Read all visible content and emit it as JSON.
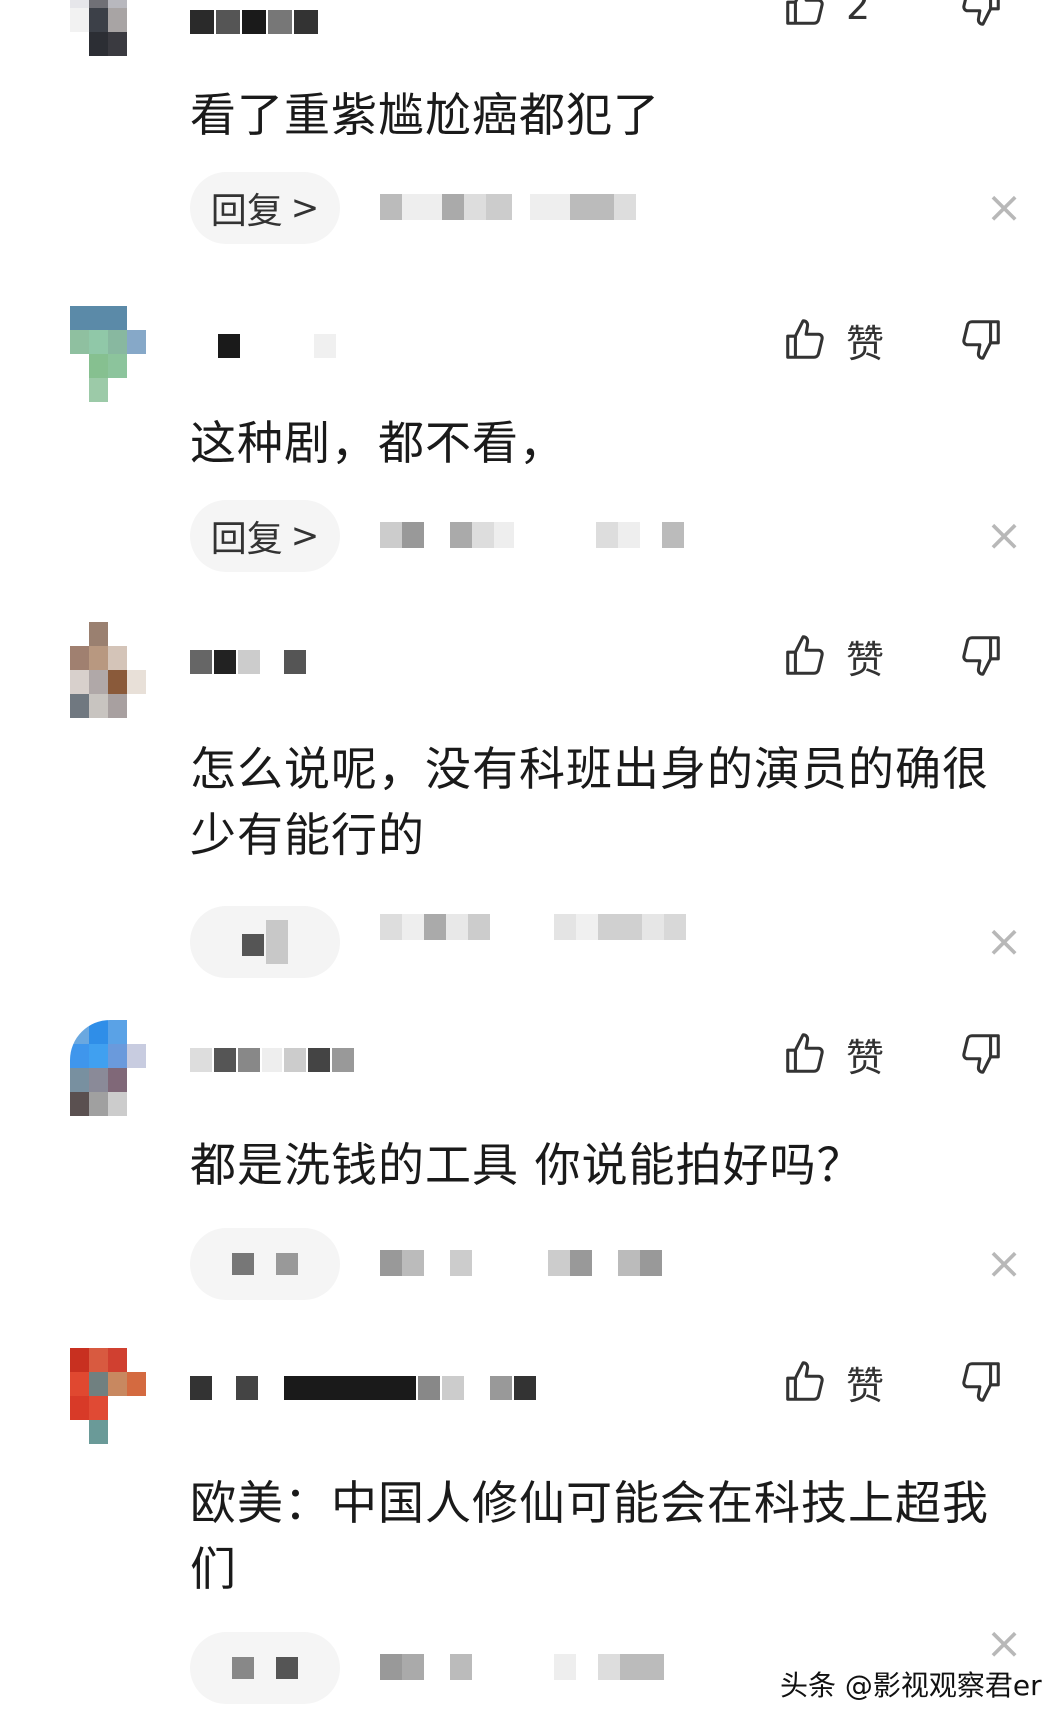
{
  "comments": [
    {
      "like_label": "2",
      "text": "看了重紫尴尬癌都犯了",
      "reply_label": "回复",
      "reply_chevron": ">",
      "close_glyph": "×"
    },
    {
      "like_label": "赞",
      "text": "这种剧，都不看，",
      "reply_label": "回复",
      "reply_chevron": ">",
      "close_glyph": "×"
    },
    {
      "like_label": "赞",
      "text": "怎么说呢，没有科班出身的演员的确很少有能行的",
      "reply_label": "",
      "close_glyph": "×"
    },
    {
      "like_label": "赞",
      "text": "都是洗钱的工具 你说能拍好吗？",
      "reply_label": "",
      "close_glyph": "×"
    },
    {
      "like_label": "赞",
      "text": "欧美：中国人修仙可能会在科技上超我们",
      "reply_label": "",
      "close_glyph": "×"
    }
  ],
  "watermark": "头条 @影视观察君er",
  "icons": {
    "like": "thumbs-up-icon",
    "dislike": "thumbs-down-icon",
    "close": "close-icon",
    "reply": "chevron-right-icon"
  },
  "colors": {
    "text": "#1a1a1a",
    "pill_bg": "#f5f5f5",
    "close": "#b8b8b8"
  }
}
